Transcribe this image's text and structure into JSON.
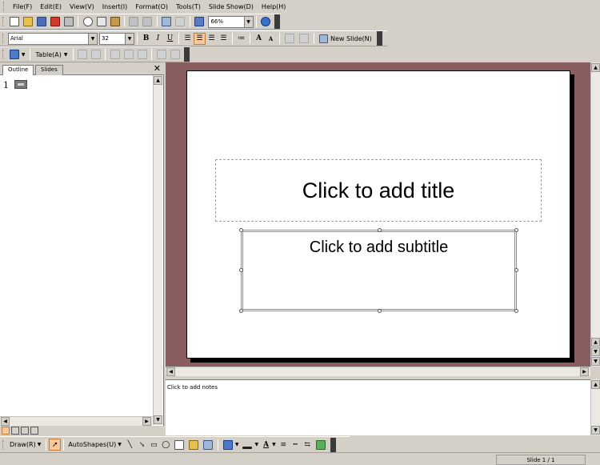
{
  "menu": [
    "File(F)",
    "Edit(E)",
    "View(V)",
    "Insert(I)",
    "Format(O)",
    "Tools(T)",
    "Slide Show(D)",
    "Help(H)"
  ],
  "standard_toolbar": {
    "zoom_value": "66%",
    "icons": [
      "new-document",
      "open-folder",
      "save",
      "export-pdf",
      "print",
      "cut",
      "copy",
      "paste",
      "undo",
      "redo",
      "slide-layout",
      "grid",
      "help"
    ]
  },
  "format_toolbar": {
    "font_name": "Arial",
    "font_size": "32",
    "bold": "B",
    "italic": "I",
    "underline": "U",
    "grow_font": "A",
    "shrink_font": "A",
    "new_slide_label": "New Slide(N)"
  },
  "table_toolbar": {
    "table_label": "Table(A)"
  },
  "left_panel": {
    "tabs": [
      "Outline",
      "Slides"
    ],
    "outline_number": "1"
  },
  "slide": {
    "title_placeholder": "Click to add title",
    "subtitle_placeholder": "Click to add subtitle"
  },
  "notes": {
    "placeholder": "Click to add notes"
  },
  "draw_toolbar": {
    "draw_label": "Draw(R)",
    "autoshapes_label": "AutoShapes(U)",
    "font_color_glyph": "A"
  },
  "status": {
    "slide_indicator": "Slide 1 / 1"
  },
  "colors": {
    "workspace_bg": "#8a5e5e",
    "ui_bg": "#d4d0c8",
    "active_button": "#f7c89a"
  }
}
